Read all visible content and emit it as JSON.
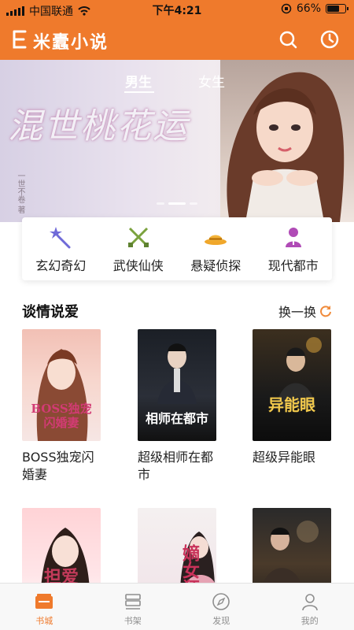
{
  "status_bar": {
    "carrier": "中国联通",
    "time": "下午4:21",
    "battery": "66%",
    "battery_level": 0.66
  },
  "header": {
    "title": "米蠹小说",
    "logo_icon": "book-logo-icon",
    "search_icon": "search-icon",
    "history_icon": "clock-icon"
  },
  "banner": {
    "tabs": [
      "男生",
      "女生"
    ],
    "active_tab": 0,
    "title": "混世桃花运",
    "author_vertical": "一世不卷 著",
    "slide_count": 3,
    "active_slide": 1
  },
  "categories": [
    {
      "label": "玄幻奇幻",
      "icon": "magic-wand-icon"
    },
    {
      "label": "武侠仙侠",
      "icon": "crossed-swords-icon"
    },
    {
      "label": "悬疑侦探",
      "icon": "detective-hat-icon"
    },
    {
      "label": "现代都市",
      "icon": "person-icon"
    }
  ],
  "section": {
    "title": "谈情说爱",
    "refresh_label": "换一换",
    "refresh_icon": "refresh-icon"
  },
  "books": [
    {
      "title": "BOSS独宠闪婚妻",
      "cover_text": "BOSS独宠\n闪婚妻"
    },
    {
      "title": "超级相师在都市",
      "cover_text": "相师在都市"
    },
    {
      "title": "超级异能眼",
      "cover_text": "异能眼"
    },
    {
      "title": "",
      "cover_text": "担爱"
    },
    {
      "title": "",
      "cover_text": "嫡女狂妃"
    },
    {
      "title": "",
      "cover_text": ""
    }
  ],
  "bottom_nav": [
    {
      "label": "书城",
      "icon": "bookstore-icon",
      "active": true
    },
    {
      "label": "书架",
      "icon": "bookshelf-icon",
      "active": false
    },
    {
      "label": "发现",
      "icon": "compass-icon",
      "active": false
    },
    {
      "label": "我的",
      "icon": "user-icon",
      "active": false
    }
  ],
  "colors": {
    "brand": "#ef7a2c",
    "refresh": "#f08a3a"
  }
}
